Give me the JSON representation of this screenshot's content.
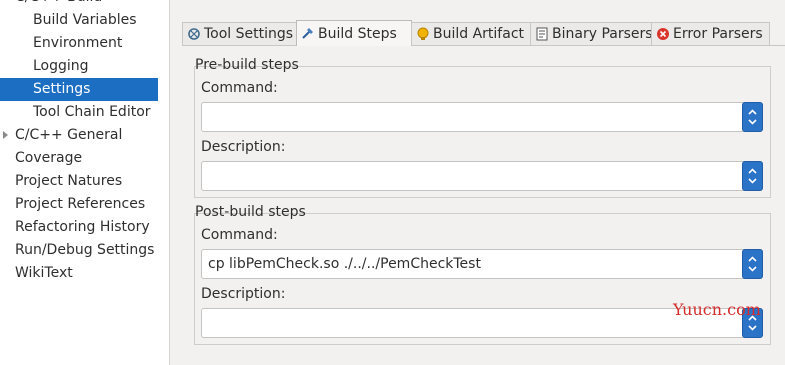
{
  "tree": {
    "cut_item": "C/C++ Build",
    "items": [
      {
        "label": "Build Variables",
        "level": "child"
      },
      {
        "label": "Environment",
        "level": "child"
      },
      {
        "label": "Logging",
        "level": "child"
      },
      {
        "label": "Settings",
        "level": "child",
        "selected": true
      },
      {
        "label": "Tool Chain Editor",
        "level": "child"
      },
      {
        "label": "C/C++ General",
        "level": "top",
        "expandable": true
      },
      {
        "label": "Coverage",
        "level": "top"
      },
      {
        "label": "Project Natures",
        "level": "top"
      },
      {
        "label": "Project References",
        "level": "top"
      },
      {
        "label": "Refactoring History",
        "level": "top"
      },
      {
        "label": "Run/Debug Settings",
        "level": "top"
      },
      {
        "label": "WikiText",
        "level": "top"
      }
    ]
  },
  "tabs": [
    {
      "label": "Tool Settings",
      "icon": "tool-settings-icon"
    },
    {
      "label": "Build Steps",
      "icon": "build-steps-icon",
      "active": true
    },
    {
      "label": "Build Artifact",
      "icon": "build-artifact-icon"
    },
    {
      "label": "Binary Parsers",
      "icon": "binary-parsers-icon"
    },
    {
      "label": "Error Parsers",
      "icon": "error-parsers-icon"
    }
  ],
  "pre_build": {
    "title": "Pre-build steps",
    "command_label": "Command:",
    "command_value": "",
    "description_label": "Description:",
    "description_value": ""
  },
  "post_build": {
    "title": "Post-build steps",
    "command_label": "Command:",
    "command_value": "cp libPemCheck.so ./../../PemCheckTest",
    "description_label": "Description:",
    "description_value": ""
  },
  "watermark": "Yuucn.com",
  "colors": {
    "selection": "#1b6ec2",
    "combo_arrow": "#2b73c7",
    "watermark": "#d42c2c"
  }
}
